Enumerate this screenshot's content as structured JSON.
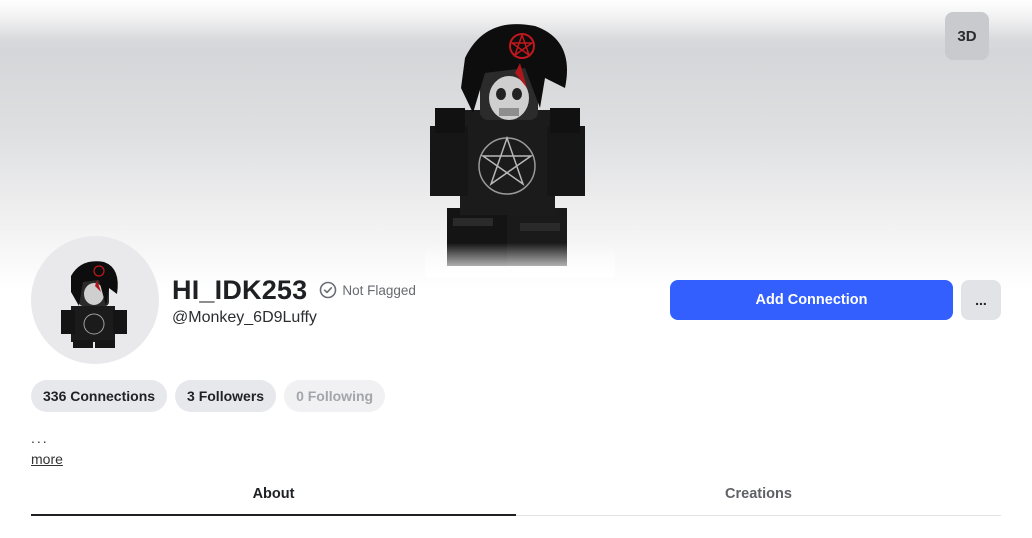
{
  "hero": {
    "view_toggle_label": "3D"
  },
  "profile": {
    "display_name": "HI_IDK253",
    "flag_status": "Not Flagged",
    "username": "@Monkey_6D9Luffy"
  },
  "actions": {
    "add_connection_label": "Add Connection",
    "more_options_label": "..."
  },
  "stats": {
    "connections": "336 Connections",
    "followers": "3 Followers",
    "following": "0 Following"
  },
  "bio": {
    "ellipsis": "...",
    "more_link": "more"
  },
  "tabs": [
    {
      "label": "About",
      "active": true
    },
    {
      "label": "Creations",
      "active": false
    }
  ],
  "colors": {
    "primary_button": "#335fff",
    "pill_background": "#e7e8eb",
    "tab_underline": "#1e2024"
  },
  "icons": [
    "check-circle-icon",
    "avatar-3d-figure",
    "avatar-headshot"
  ]
}
